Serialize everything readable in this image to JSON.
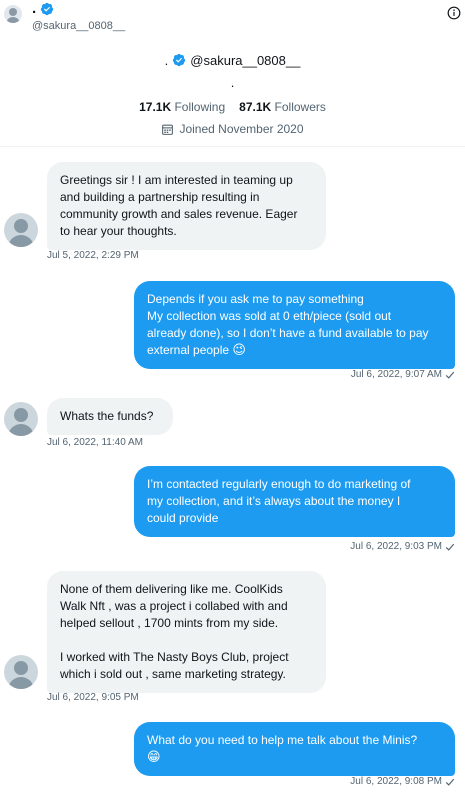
{
  "header": {
    "name": ".",
    "handle": "@sakura__0808__"
  },
  "profile": {
    "name": ".",
    "handle": "@sakura__0808__",
    "bio": ".",
    "following_count": "17.1K",
    "following_label": "Following",
    "followers_count": "87.1K",
    "followers_label": "Followers",
    "joined": "Joined November 2020"
  },
  "messages": [
    {
      "dir": "in",
      "text": "Greetings sir ! I am interested in teaming up\nand building a partnership resulting in\ncommunity growth and sales revenue. Eager\nto hear your thoughts.",
      "time": "Jul 5, 2022, 2:29 PM"
    },
    {
      "dir": "out",
      "text": "Depends if you ask me to pay something\nMy collection was sold at 0 eth/piece (sold out\nalready done), so I don’t have a fund available to pay\nexternal people",
      "emoji": "😉",
      "time": "Jul 6, 2022, 9:07 AM"
    },
    {
      "dir": "in",
      "text": "Whats the funds?",
      "time": "Jul 6, 2022, 11:40 AM"
    },
    {
      "dir": "out",
      "text": "I’m contacted regularly enough to do marketing of\nmy collection, and it’s always about the money I\ncould provide",
      "time": "Jul 6, 2022, 9:03 PM"
    },
    {
      "dir": "in",
      "text": "None of them delivering like me. CoolKids\nWalk Nft , was a project i collabed with and\nhelped sellout , 1700 mints from my side.\n\nI worked with The Nasty Boys Club, project\nwhich i sold out , same marketing strategy.",
      "time": "Jul 6, 2022, 9:05 PM"
    },
    {
      "dir": "out",
      "text": "What do you need to help me talk about the Minis?",
      "emoji": "😁",
      "time": "Jul 6, 2022, 9:08 PM"
    }
  ],
  "colors": {
    "accent": "#1d9bf0",
    "incoming_bubble": "#eff3f4",
    "muted_text": "#536471"
  },
  "icons": [
    "verified-badge-icon",
    "info-icon",
    "calendar-icon",
    "sent-check-icon"
  ]
}
